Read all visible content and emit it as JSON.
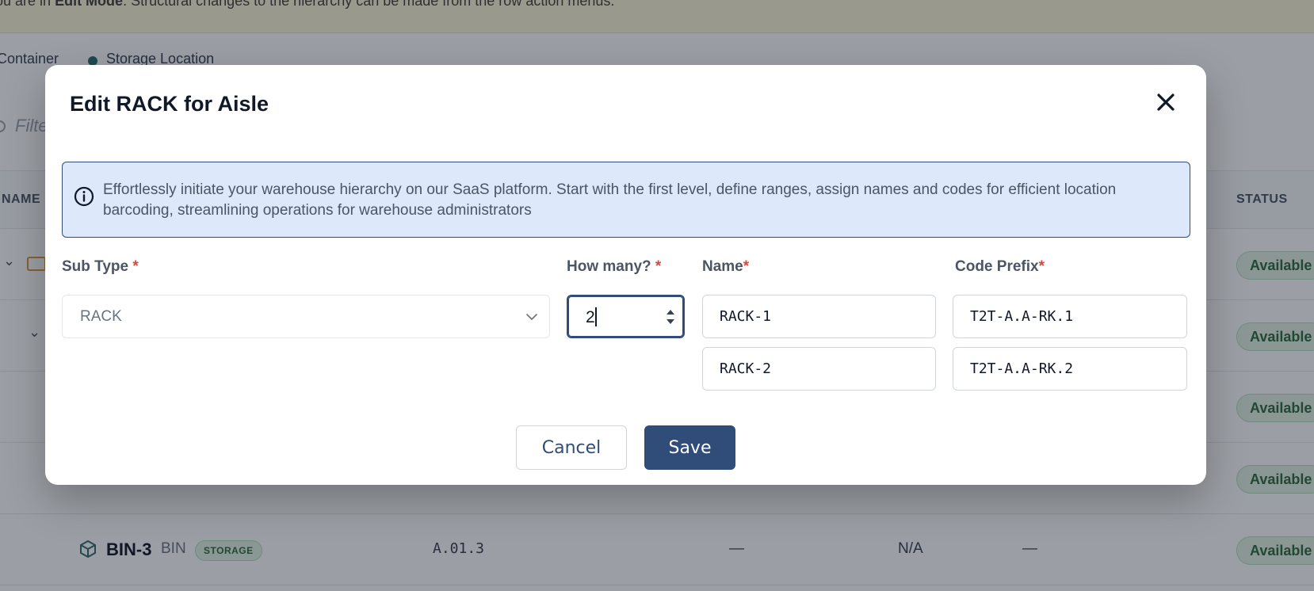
{
  "background": {
    "banner": {
      "prefix": "ou are in ",
      "mode": "Edit Mode",
      "suffix": ". Structural changes to the hierarchy can be made from the row action menus."
    },
    "legend": {
      "item1": "Container",
      "item2": "Storage Location"
    },
    "filter": {
      "placeholder": "Filte"
    },
    "table": {
      "headers": {
        "name": "NAME",
        "status": "STATUS"
      },
      "status_value": "Available",
      "last_row": {
        "name": "BIN-3",
        "type": "BIN",
        "badge": "STORAGE",
        "code": "A.01.3",
        "col4": "—",
        "col5": "N/A",
        "col6": "—"
      }
    }
  },
  "modal": {
    "title": "Edit RACK for Aisle",
    "close_icon": "close-icon",
    "info_icon": "info-circle-icon",
    "info_text": "Effortlessly initiate your warehouse hierarchy on our SaaS platform. Start with the first level, define ranges, assign names and codes for efficient location barcoding, streamlining operations for warehouse administrators",
    "fields": {
      "sub_type": {
        "label": "Sub Type",
        "required_mark": "*",
        "value": "RACK"
      },
      "how_many": {
        "label": "How many?",
        "required_mark": "*",
        "value": "2"
      },
      "name": {
        "label": "Name",
        "required_mark": "*",
        "values": [
          "RACK-1",
          "RACK-2"
        ]
      },
      "code_prefix": {
        "label": "Code Prefix",
        "required_mark": "*",
        "values": [
          "T2T-A.A-RK.1",
          "T2T-A.A-RK.2"
        ]
      }
    },
    "buttons": {
      "cancel": "Cancel",
      "save": "Save"
    }
  },
  "colors": {
    "accent": "#2f4d78",
    "info_bg": "#dde8fb",
    "required": "#d9463b",
    "status_green": "#2f6b3f"
  }
}
